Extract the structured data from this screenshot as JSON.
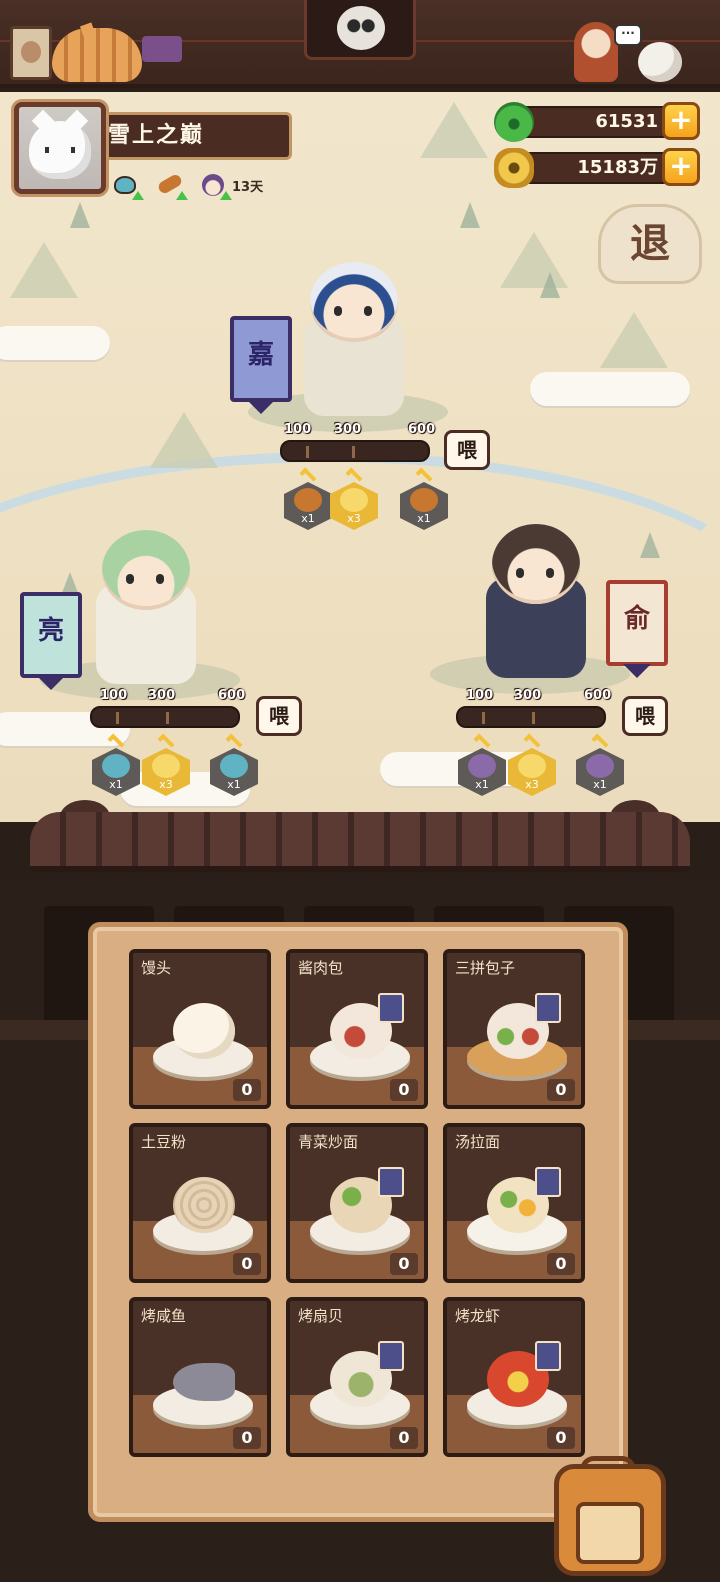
{
  "player": {
    "name": "雪上之巅",
    "buff_days": "13天"
  },
  "currency": {
    "jade": {
      "value": "61531",
      "plus": "+"
    },
    "coins": {
      "value": "15183万",
      "plus": "+"
    }
  },
  "buttons": {
    "retreat": "退"
  },
  "generals": [
    {
      "flag": "嘉",
      "thresholds": [
        "100",
        "300",
        "600"
      ],
      "feed_label": "喂",
      "feed_progress": 0,
      "rewards": [
        {
          "icon": "arrow-icon",
          "count": "x1"
        },
        {
          "icon": "gold-star-icon",
          "count": "x3"
        },
        {
          "icon": "arrow-icon",
          "count": "x1"
        }
      ]
    },
    {
      "flag": "亮",
      "thresholds": [
        "100",
        "300",
        "600"
      ],
      "feed_label": "喂",
      "feed_progress": 0,
      "rewards": [
        {
          "icon": "food-bowl-icon",
          "count": "x1"
        },
        {
          "icon": "gold-star-icon",
          "count": "x3"
        },
        {
          "icon": "food-bowl-icon",
          "count": "x1"
        }
      ]
    },
    {
      "flag": "俞",
      "thresholds": [
        "100",
        "300",
        "600"
      ],
      "feed_label": "喂",
      "feed_progress": 0,
      "rewards": [
        {
          "icon": "character-icon",
          "count": "x1"
        },
        {
          "icon": "gold-star-icon",
          "count": "x3"
        },
        {
          "icon": "character-icon",
          "count": "x1"
        }
      ]
    }
  ],
  "foods": [
    {
      "name": "馒头",
      "count": "0"
    },
    {
      "name": "酱肉包",
      "count": "0"
    },
    {
      "name": "三拼包子",
      "count": "0"
    },
    {
      "name": "土豆粉",
      "count": "0"
    },
    {
      "name": "青菜炒面",
      "count": "0"
    },
    {
      "name": "汤拉面",
      "count": "0"
    },
    {
      "name": "烤咸鱼",
      "count": "0"
    },
    {
      "name": "烤扇贝",
      "count": "0"
    },
    {
      "name": "烤龙虾",
      "count": "0"
    }
  ],
  "colors": {
    "wood_dark": "#4b2c22",
    "panel": "#d8ae82",
    "gold": "#f4c23a",
    "jade": "#49b846"
  }
}
